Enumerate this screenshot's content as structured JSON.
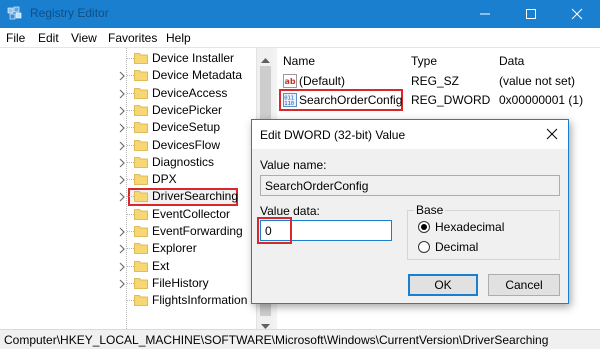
{
  "window": {
    "title": "Registry Editor",
    "accent_color": "#1a7fcf",
    "highlight_color": "#d9282b"
  },
  "menu": [
    "File",
    "Edit",
    "View",
    "Favorites",
    "Help"
  ],
  "tree": {
    "items": [
      {
        "label": "Device Installer",
        "expandable": false
      },
      {
        "label": "Device Metadata",
        "expandable": true
      },
      {
        "label": "DeviceAccess",
        "expandable": true
      },
      {
        "label": "DevicePicker",
        "expandable": true
      },
      {
        "label": "DeviceSetup",
        "expandable": true
      },
      {
        "label": "DevicesFlow",
        "expandable": true
      },
      {
        "label": "Diagnostics",
        "expandable": true
      },
      {
        "label": "DPX",
        "expandable": true
      },
      {
        "label": "DriverSearching",
        "expandable": true,
        "selected": true
      },
      {
        "label": "EventCollector",
        "expandable": false
      },
      {
        "label": "EventForwarding",
        "expandable": true
      },
      {
        "label": "Explorer",
        "expandable": true
      },
      {
        "label": "Ext",
        "expandable": true
      },
      {
        "label": "FileHistory",
        "expandable": true
      },
      {
        "label": "FlightsInformation",
        "expandable": false
      }
    ]
  },
  "list": {
    "headers": {
      "name": "Name",
      "type": "Type",
      "data": "Data"
    },
    "rows": [
      {
        "name": "(Default)",
        "type": "REG_SZ",
        "data": "(value not set)",
        "icon": "string-value-icon"
      },
      {
        "name": "SearchOrderConfig",
        "type": "REG_DWORD",
        "data": "0x00000001 (1)",
        "icon": "dword-value-icon",
        "highlighted": true
      }
    ]
  },
  "dialog": {
    "title": "Edit DWORD (32-bit) Value",
    "value_name_label": "Value name:",
    "value_name": "SearchOrderConfig",
    "value_data_label": "Value data:",
    "value_data": "0",
    "base_label": "Base",
    "base_options": [
      {
        "label": "Hexadecimal",
        "selected": true
      },
      {
        "label": "Decimal",
        "selected": false
      }
    ],
    "ok_label": "OK",
    "cancel_label": "Cancel"
  },
  "status": {
    "path": "Computer\\HKEY_LOCAL_MACHINE\\SOFTWARE\\Microsoft\\Windows\\CurrentVersion\\DriverSearching"
  }
}
